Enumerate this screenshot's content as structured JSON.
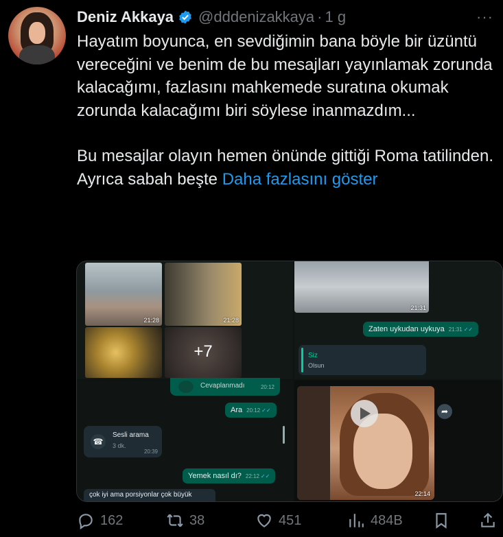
{
  "tweet": {
    "author_name": "Deniz Akkaya",
    "handle": "@dddenizakkaya",
    "separator": "·",
    "time_ago": "1 g",
    "more_label": "···",
    "paragraph1": "Hayatım boyunca, en sevdiğimin bana böyle bir üzüntü vereceğini ve benim de bu mesajları yayınlamak zorunda kalacağımı, fazlasını mahkemede suratına okumak zorunda kalacağımı biri söylese inanmazdım...",
    "paragraph2_line1": "Bu mesajlar olayın hemen önünde gittiği Roma tatilinden.",
    "paragraph2_line2": "Ayrıca sabah beşte",
    "show_more": "Daha fazlasını göster",
    "verified_color": "#1d9bf0",
    "link_color": "#1d9bf0"
  },
  "media": {
    "tl": {
      "thumb_times": [
        "21:28",
        "21:28"
      ],
      "more_count": "+7"
    },
    "tr": {
      "photo_time": "21:31",
      "message": "Zaten uykudan uykuya",
      "message_time": "21:31",
      "ticks": "✓✓",
      "reply_name": "Siz",
      "reply_text": "Olsun"
    },
    "bl": {
      "missed_label": "Cevaplanmadı",
      "missed_time": "20:12",
      "msg1": "Ara",
      "msg1_time": "20:12",
      "call_label": "Sesli arama",
      "call_duration": "3 dk.",
      "call_time": "20:39",
      "msg2": "Yemek nasıl dı?",
      "msg2_time": "22:12",
      "ticks": "✓✓",
      "incoming": "çok iyi ama porsiyonlar çok büyük"
    },
    "br": {
      "video_time": "22:14"
    }
  },
  "actions": {
    "replies": "162",
    "retweets": "38",
    "likes": "451",
    "views": "484B"
  }
}
